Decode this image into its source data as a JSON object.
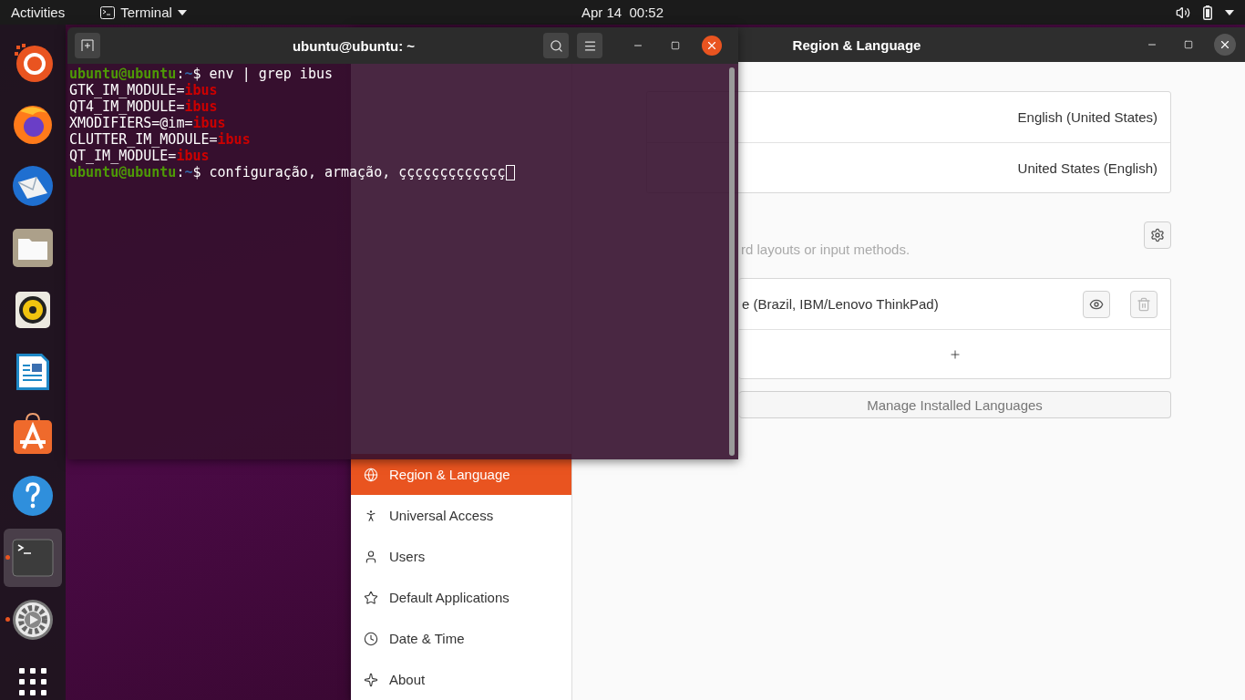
{
  "top_bar": {
    "activities": "Activities",
    "app_menu": "Terminal",
    "clock": "Apr 14  00:52"
  },
  "dock": {
    "items": [
      {
        "kind": "installer",
        "running": false,
        "selected": false
      },
      {
        "kind": "browser",
        "running": false,
        "selected": false
      },
      {
        "kind": "mail",
        "running": false,
        "selected": false
      },
      {
        "kind": "files",
        "running": false,
        "selected": false
      },
      {
        "kind": "music",
        "running": false,
        "selected": false
      },
      {
        "kind": "writer",
        "running": false,
        "selected": false
      },
      {
        "kind": "store",
        "running": false,
        "selected": false
      },
      {
        "kind": "help",
        "running": false,
        "selected": false
      },
      {
        "kind": "terminal",
        "running": true,
        "selected": true
      },
      {
        "kind": "settings",
        "running": true,
        "selected": false
      },
      {
        "kind": "apps",
        "running": false,
        "selected": false
      }
    ]
  },
  "settings": {
    "title": "Region & Language",
    "sidebar": [
      {
        "kind": "region",
        "label": "Region & Language",
        "selected": true
      },
      {
        "kind": "access",
        "label": "Universal Access",
        "selected": false
      },
      {
        "kind": "users",
        "label": "Users",
        "selected": false
      },
      {
        "kind": "default",
        "label": "Default Applications",
        "selected": false
      },
      {
        "kind": "date",
        "label": "Date & Time",
        "selected": false
      },
      {
        "kind": "about",
        "label": "About",
        "selected": false
      }
    ],
    "rows": [
      {
        "value": "English (United States)"
      },
      {
        "value": "United States (English)"
      }
    ],
    "input_sources": {
      "hint": "rd layouts or input methods.",
      "items": [
        {
          "name": "e (Brazil, IBM/Lenovo ThinkPad)"
        }
      ]
    },
    "manage_button": "Manage Installed Languages"
  },
  "terminal": {
    "title": "ubuntu@ubuntu: ~",
    "lines": [
      {
        "kind": "prompt",
        "user": "ubuntu@ubuntu",
        "separator": ":",
        "path": "~",
        "symbol": "$",
        "command": "env | grep ibus",
        "cursor": false
      },
      {
        "kind": "output",
        "key": "GTK_IM_MODULE=",
        "value": "ibus"
      },
      {
        "kind": "output",
        "key": "QT4_IM_MODULE=",
        "value": "ibus"
      },
      {
        "kind": "output",
        "key": "XMODIFIERS=@im=",
        "value": "ibus"
      },
      {
        "kind": "output",
        "key": "CLUTTER_IM_MODULE=",
        "value": "ibus"
      },
      {
        "kind": "output",
        "key": "QT_IM_MODULE=",
        "value": "ibus"
      },
      {
        "kind": "prompt",
        "user": "ubuntu@ubuntu",
        "separator": ":",
        "path": "~",
        "symbol": "$",
        "command": "configuração, armação, ççççççççççççç",
        "cursor": true
      }
    ]
  }
}
